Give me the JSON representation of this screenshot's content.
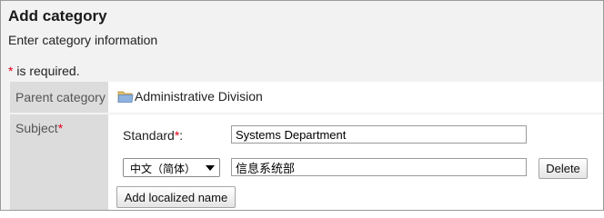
{
  "header": {
    "title": "Add category",
    "subtitle": "Enter category information"
  },
  "required_note": {
    "star": "*",
    "text": " is required."
  },
  "form": {
    "parent_category": {
      "label": "Parent category",
      "value": "Administrative Division",
      "icon": "folder-icon"
    },
    "subject": {
      "label": "Subject",
      "required_star": "*",
      "standard_label": "Standard",
      "standard_star": "*",
      "standard_colon": ":",
      "standard_value": "Systems Department",
      "language_selected": "中文（简体）",
      "localized_value": "信息系统部",
      "delete_label": "Delete",
      "add_localized_label": "Add localized name"
    }
  },
  "colors": {
    "required": "#e0001b",
    "label_column": "#dcdcdc",
    "page_background": "#f2f2f2"
  }
}
